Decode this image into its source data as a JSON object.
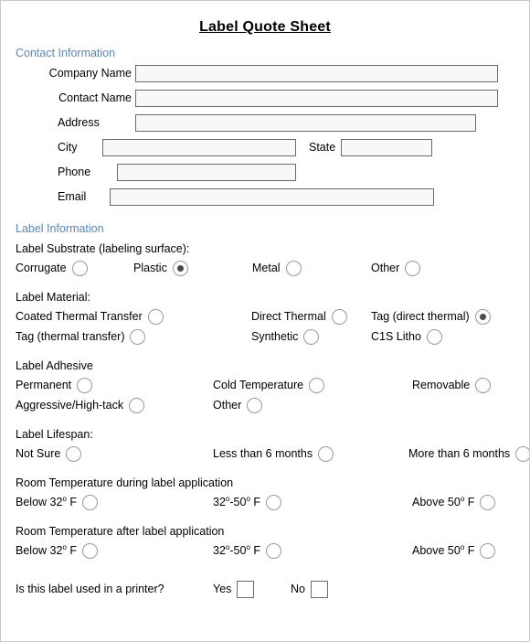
{
  "document": {
    "title": "Label Quote Sheet"
  },
  "contact": {
    "heading": "Contact Information",
    "fields": [
      {
        "label": "Company Name",
        "value": ""
      },
      {
        "label": "Contact Name",
        "value": ""
      },
      {
        "label": "Address",
        "value": ""
      },
      {
        "label": "City",
        "value": ""
      },
      {
        "label": "State",
        "value": ""
      },
      {
        "label": "Phone",
        "value": ""
      },
      {
        "label": "Email",
        "value": ""
      }
    ]
  },
  "label_info": {
    "heading": "Label Information",
    "substrate": {
      "label": "Label Substrate (labeling surface):",
      "options": [
        {
          "label": "Corrugate",
          "checked": false
        },
        {
          "label": "Plastic",
          "checked": true
        },
        {
          "label": "Metal",
          "checked": false
        },
        {
          "label": "Other",
          "checked": false
        }
      ]
    },
    "material": {
      "label": "Label Material:",
      "options": [
        {
          "label": "Coated Thermal Transfer",
          "checked": false
        },
        {
          "label": "Direct Thermal",
          "checked": false
        },
        {
          "label": "Tag (direct thermal)",
          "checked": true
        },
        {
          "label": "Tag (thermal transfer)",
          "checked": false
        },
        {
          "label": "Synthetic",
          "checked": false
        },
        {
          "label": "C1S Litho",
          "checked": false
        }
      ]
    },
    "adhesive": {
      "label": "Label Adhesive",
      "options": [
        {
          "label": "Permanent",
          "checked": false
        },
        {
          "label": "Cold Temperature",
          "checked": false
        },
        {
          "label": "Removable",
          "checked": false
        },
        {
          "label": "Aggressive/High-tack",
          "checked": false
        },
        {
          "label": "Other",
          "checked": false
        }
      ]
    },
    "lifespan": {
      "label": "Label Lifespan:",
      "options": [
        {
          "label": "Not Sure",
          "checked": false
        },
        {
          "label": "Less than 6 months",
          "checked": false
        },
        {
          "label": "More than 6 months",
          "checked": false
        }
      ]
    },
    "temp_during": {
      "label": "Room Temperature during label application",
      "options": [
        {
          "prefix": "Below 32",
          "degree": "o",
          "suffix": " F",
          "checked": false
        },
        {
          "prefix": "32",
          "degree": "o",
          "suffix": "-50",
          "degree2": "o",
          "suffix2": " F",
          "checked": false
        },
        {
          "prefix": "Above 50",
          "degree": "o",
          "suffix": " F",
          "checked": false
        }
      ]
    },
    "temp_after": {
      "label": "Room Temperature after label application",
      "options": [
        {
          "prefix": "Below 32",
          "degree": "o",
          "suffix": " F",
          "checked": false
        },
        {
          "prefix": "32",
          "degree": "o",
          "suffix": "-50",
          "degree2": "o",
          "suffix2": " F",
          "checked": false
        },
        {
          "prefix": "Above 50",
          "degree": "o",
          "suffix": " F",
          "checked": false
        }
      ]
    },
    "printer": {
      "question": "Is this label used in a printer?",
      "yes_label": "Yes",
      "no_label": "No",
      "yes_checked": false,
      "no_checked": false
    }
  },
  "colors": {
    "section_heading": "#5b87b5",
    "field_border": "#6b6b6b",
    "field_fill": "#f7f8fa",
    "radio_border": "#9a9a9a",
    "radio_dot": "#4a4a4a"
  }
}
